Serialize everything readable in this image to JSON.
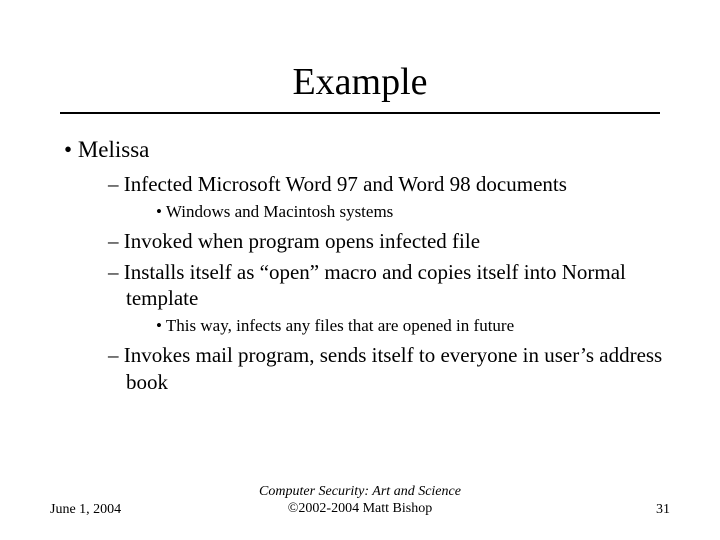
{
  "title": "Example",
  "bullets": {
    "b1": "Melissa",
    "b1a": "Infected Microsoft Word 97 and Word 98 documents",
    "b1a_i": "Windows and Macintosh systems",
    "b1b": "Invoked when program opens infected file",
    "b1c": "Installs itself as “open” macro and copies itself into Normal template",
    "b1c_i": "This way, infects any files that are opened in future",
    "b1d": "Invokes mail program, sends itself to everyone in user’s address book"
  },
  "footer": {
    "date": "June 1, 2004",
    "center_line1": "Computer Security: Art and Science",
    "center_line2": "©2002-2004 Matt Bishop",
    "page": "31"
  }
}
